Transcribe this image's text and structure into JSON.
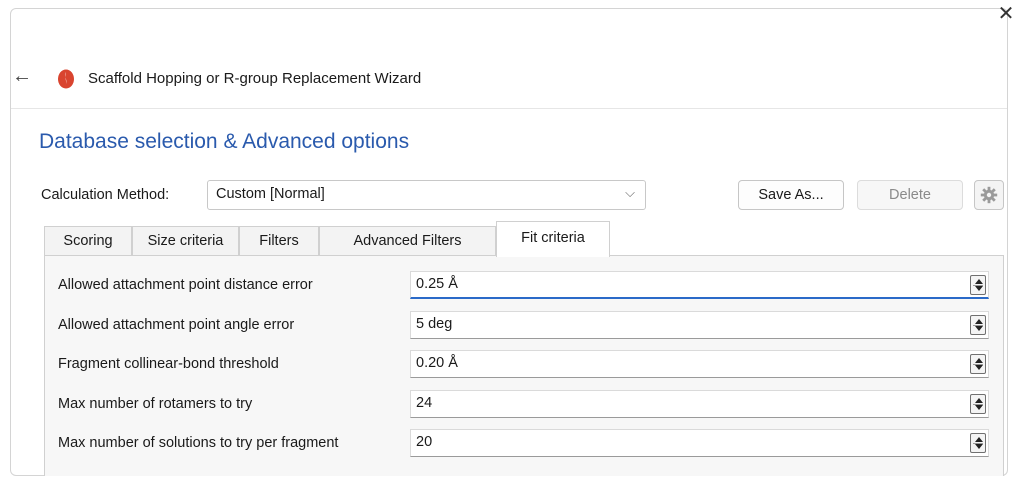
{
  "window": {
    "title": "Scaffold Hopping or R-group Replacement Wizard",
    "close_glyph": "✕",
    "back_glyph": "←"
  },
  "section_title": "Database selection & Advanced options",
  "calculation": {
    "label": "Calculation Method:",
    "selected": "Custom [Normal]"
  },
  "buttons": {
    "save_as": "Save As...",
    "delete": "Delete",
    "settings_icon": "gear-icon"
  },
  "tabs": [
    {
      "label": "Scoring",
      "active": false
    },
    {
      "label": "Size criteria",
      "active": false
    },
    {
      "label": "Filters",
      "active": false
    },
    {
      "label": "Advanced Filters",
      "active": false
    },
    {
      "label": "Fit criteria",
      "active": true
    }
  ],
  "fit_criteria": [
    {
      "label": "Allowed attachment point distance error",
      "value": "0.25 Å"
    },
    {
      "label": "Allowed attachment point angle error",
      "value": "5 deg"
    },
    {
      "label": "Fragment collinear-bond threshold",
      "value": "0.20 Å"
    },
    {
      "label": "Max number of rotamers to try",
      "value": "24"
    },
    {
      "label": "Max number of solutions to try per fragment",
      "value": "20"
    }
  ],
  "colors": {
    "accent": "#2a5aad",
    "logo": "#d9442f",
    "focus": "#2a6ac8"
  }
}
